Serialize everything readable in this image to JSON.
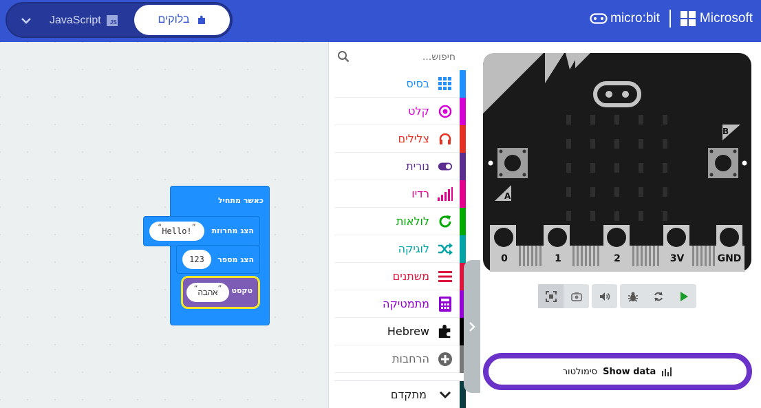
{
  "header": {
    "js_label": "JavaScript",
    "js_badge": "JS",
    "blocks_label": "בלוקים",
    "brand_microbit": "micro:bit",
    "brand_microsoft": "Microsoft"
  },
  "workspace": {
    "on_start_label": "כאשר מתחיל",
    "show_string_label": "הצג מחרוזת",
    "show_string_value": "Hello!",
    "show_number_label": "הצג מספר",
    "show_number_value": "123",
    "text_label": "טקסט",
    "text_value": "אהבה",
    "quote_open": "“",
    "quote_close": "”"
  },
  "toolbox": {
    "search_placeholder": "חיפוש...",
    "categories": [
      {
        "label": "בסיס",
        "color": "#1e90ff",
        "icon": "grid-icon"
      },
      {
        "label": "קלט",
        "color": "#d400d4",
        "icon": "target-icon"
      },
      {
        "label": "צלילים",
        "color": "#e63022",
        "icon": "headphones-icon"
      },
      {
        "label": "נורית",
        "color": "#5c2d91",
        "icon": "toggle-icon"
      },
      {
        "label": "רדיו",
        "color": "#e3008c",
        "icon": "signal-icon"
      },
      {
        "label": "לולאות",
        "color": "#00aa00",
        "icon": "refresh-icon"
      },
      {
        "label": "לוגיקה",
        "color": "#00a4a6",
        "icon": "shuffle-icon"
      },
      {
        "label": "משתנים",
        "color": "#dc143c",
        "icon": "list-icon"
      },
      {
        "label": "מתמטיקה",
        "color": "#9400d3",
        "icon": "calculator-icon"
      },
      {
        "label": "Hebrew",
        "color": "#000000",
        "icon": "puzzle-icon"
      },
      {
        "label": "הרחבות",
        "color": "#777777",
        "icon": "plus-circle-icon"
      }
    ],
    "advanced_label": "מתקדם"
  },
  "simulator": {
    "pin_labels": [
      "0",
      "1",
      "2",
      "3V",
      "GND"
    ],
    "button_a": "A",
    "button_b": "B",
    "show_data_simulator": "סימולטור",
    "show_data_label": "Show data"
  },
  "colors": {
    "header": "#3454d1",
    "blocks_basic": "#1e90ff",
    "text_block": "#7c5cb5",
    "highlight": "#f7e628",
    "show_data_border": "#6a32c9"
  }
}
